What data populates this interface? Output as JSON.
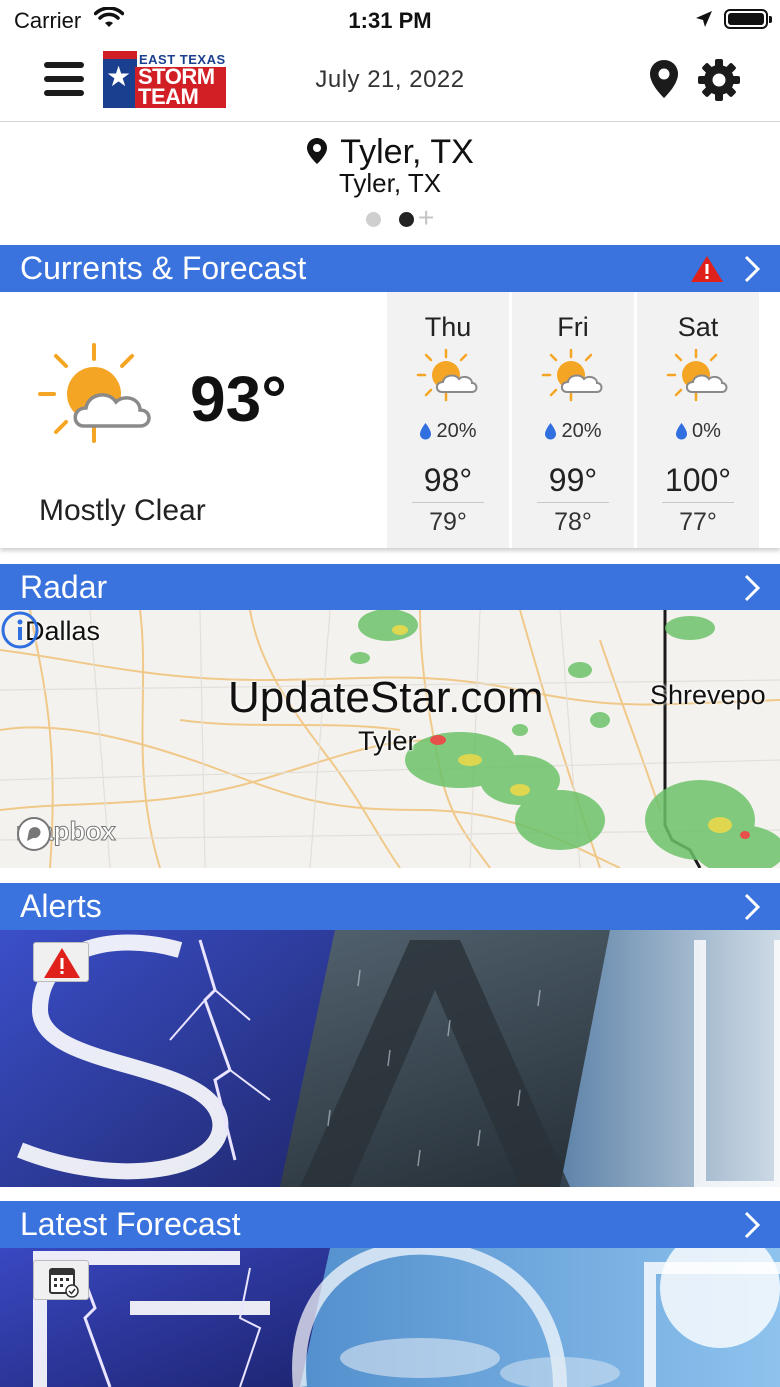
{
  "status_bar": {
    "carrier": "Carrier",
    "time": "1:31 PM"
  },
  "header": {
    "logo_top": "EAST TEXAS",
    "logo_line1": "STORM",
    "logo_line2": "TEAM",
    "date": "July 21, 2022"
  },
  "location": {
    "name": "Tyler, TX",
    "subtitle": "Tyler, TX",
    "page_count": 2,
    "active_page": 2
  },
  "currents": {
    "title": "Currents & Forecast",
    "temp": "93°",
    "condition": "Mostly Clear",
    "icon": "partly-cloudy-icon",
    "forecast": [
      {
        "day": "Thu",
        "rain": "20%",
        "hi": "98°",
        "lo": "79°"
      },
      {
        "day": "Fri",
        "rain": "20%",
        "hi": "99°",
        "lo": "78°"
      },
      {
        "day": "Sat",
        "rain": "0%",
        "hi": "100°",
        "lo": "77°"
      }
    ]
  },
  "radar": {
    "title": "Radar",
    "cities": {
      "dallas": "Dallas",
      "tyler": "Tyler",
      "shreveport": "Shrevepo"
    },
    "watermark": "UpdateStar.com",
    "attribution": "mapbox"
  },
  "alerts": {
    "title": "Alerts"
  },
  "latest_forecast": {
    "title": "Latest Forecast"
  },
  "colors": {
    "section_header": "#3a73de",
    "alert_red": "#e0201b",
    "sun": "#f5a524"
  }
}
